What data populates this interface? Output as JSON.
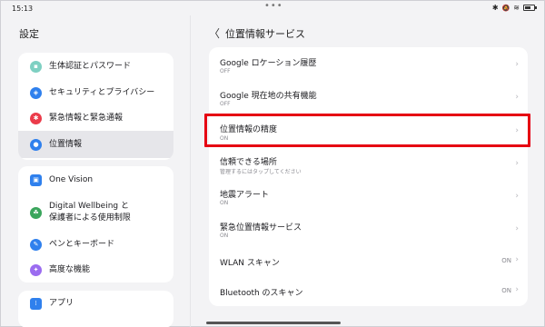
{
  "status": {
    "time": "15:13",
    "dots": "•••",
    "bt": "✱",
    "mute": "🔕",
    "wifi": "≋"
  },
  "left": {
    "title": "設定",
    "group1": [
      {
        "label": "生体認証とパスワード",
        "icon": "lock-icon",
        "color": "#7ed0c2",
        "glyph": "🔒"
      },
      {
        "label": "セキュリティとプライバシー",
        "icon": "shield-icon",
        "color": "#2f80ed",
        "glyph": "◉"
      },
      {
        "label": "緊急情報と緊急通報",
        "icon": "emergency-icon",
        "color": "#eb3b4a",
        "glyph": "✱"
      },
      {
        "label": "位置情報",
        "icon": "location-icon",
        "color": "#2f80ed",
        "glyph": "●"
      }
    ],
    "group2": [
      {
        "label": "One Vision",
        "icon": "one-vision-icon",
        "color": "#2f80ed",
        "glyph": "▣"
      },
      {
        "label": "Digital Wellbeing と",
        "label2": "保護者による使用制限",
        "icon": "wellbeing-icon",
        "color": "#3aa55c",
        "glyph": "☘"
      },
      {
        "label": "ペンとキーボード",
        "icon": "pen-icon",
        "color": "#2f80ed",
        "glyph": "✎"
      },
      {
        "label": "高度な機能",
        "icon": "advanced-icon",
        "color": "#9b6cf0",
        "glyph": "✦"
      }
    ],
    "group3": [
      {
        "label": "アプリ",
        "icon": "apps-icon",
        "color": "#2f80ed",
        "glyph": "⁞"
      }
    ]
  },
  "right": {
    "back": "〈",
    "title": "位置情報サービス",
    "rows": [
      {
        "title": "Google ロケーション履歴",
        "sub": "OFF"
      },
      {
        "title": "Google 現在地の共有機能",
        "sub": "OFF"
      },
      {
        "title": "位置情報の精度",
        "sub": "ON"
      },
      {
        "title": "信頼できる場所",
        "sub": "管理するにはタップしてください"
      },
      {
        "title": "地震アラート",
        "sub": "ON"
      },
      {
        "title": "緊急位置情報サービス",
        "sub": "ON"
      },
      {
        "title": "WLAN スキャン",
        "value": "ON"
      },
      {
        "title": "Bluetooth のスキャン",
        "value": "ON"
      }
    ],
    "chevron": "›"
  },
  "colors": {
    "highlight": "#e60012",
    "selected": "#e6e6ea"
  }
}
